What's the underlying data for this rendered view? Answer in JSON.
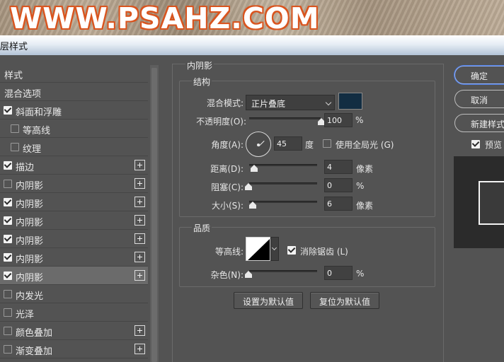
{
  "banner": {
    "text": "WWW.PSAHZ.COM"
  },
  "window": {
    "title": "层样式"
  },
  "styles_header": "样式",
  "styles": [
    {
      "label": "混合选项",
      "checkbox": null,
      "plus": false,
      "indent": false,
      "selected": false
    },
    {
      "label": "斜面和浮雕",
      "checkbox": true,
      "plus": false,
      "indent": false,
      "selected": false
    },
    {
      "label": "等高线",
      "checkbox": false,
      "plus": false,
      "indent": true,
      "selected": false
    },
    {
      "label": "纹理",
      "checkbox": false,
      "plus": false,
      "indent": true,
      "selected": false
    },
    {
      "label": "描边",
      "checkbox": true,
      "plus": true,
      "indent": false,
      "selected": false
    },
    {
      "label": "内阴影",
      "checkbox": false,
      "plus": true,
      "indent": false,
      "selected": false
    },
    {
      "label": "内阴影",
      "checkbox": true,
      "plus": true,
      "indent": false,
      "selected": false
    },
    {
      "label": "内阴影",
      "checkbox": true,
      "plus": true,
      "indent": false,
      "selected": false
    },
    {
      "label": "内阴影",
      "checkbox": true,
      "plus": true,
      "indent": false,
      "selected": false
    },
    {
      "label": "内阴影",
      "checkbox": true,
      "plus": true,
      "indent": false,
      "selected": false
    },
    {
      "label": "内阴影",
      "checkbox": true,
      "plus": true,
      "indent": false,
      "selected": true
    },
    {
      "label": "内发光",
      "checkbox": false,
      "plus": false,
      "indent": false,
      "selected": false
    },
    {
      "label": "光泽",
      "checkbox": false,
      "plus": false,
      "indent": false,
      "selected": false
    },
    {
      "label": "颜色叠加",
      "checkbox": false,
      "plus": true,
      "indent": false,
      "selected": false
    },
    {
      "label": "渐变叠加",
      "checkbox": false,
      "plus": true,
      "indent": false,
      "selected": false
    }
  ],
  "panel": {
    "title": "内阴影",
    "structure": {
      "title": "结构",
      "blend_mode_label": "混合模式:",
      "blend_mode_value": "正片叠底",
      "shadow_color": "#122d42",
      "opacity_label": "不透明度(O):",
      "opacity_value": "100",
      "opacity_level": 1.0,
      "percent": "%",
      "angle_label": "角度(A):",
      "angle_value": "45",
      "angle_unit": "度",
      "global_light_label": "使用全局光 (G)",
      "global_light_checked": false,
      "distance_label": "距离(D):",
      "distance_value": "4",
      "distance_level": 0.04,
      "px_unit": "像素",
      "choke_label": "阻塞(C):",
      "choke_value": "0",
      "choke_level": 0.0,
      "size_label": "大小(S):",
      "size_value": "6",
      "size_level": 0.06
    },
    "quality": {
      "title": "品质",
      "contour_label": "等高线:",
      "antialias_label": "消除锯齿 (L)",
      "antialias_checked": true,
      "noise_label": "杂色(N):",
      "noise_value": "0",
      "noise_level": 0.0
    },
    "set_default_label": "设置为默认值",
    "reset_default_label": "复位为默认值"
  },
  "right": {
    "ok_label": "确定",
    "cancel_label": "取消",
    "new_style_label": "新建样式",
    "preview_label": "预览",
    "preview_checked": true
  },
  "icons": {
    "checkbox_on": "checkmark-icon",
    "plus": "plus-icon",
    "dropdown": "chevron-down-icon",
    "angle": "angle-dial-icon"
  }
}
